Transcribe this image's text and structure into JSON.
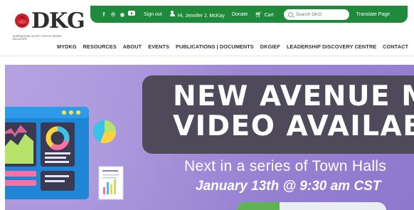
{
  "logo": {
    "text": "DKG",
    "tagline": "International Society for Key Women Educators"
  },
  "topbar": {
    "social_icons": [
      "facebook-icon",
      "pinterest-icon",
      "instagram-icon",
      "youtube-icon"
    ],
    "signout": "Sign out",
    "user": "Hi, Jennifer J. McKay",
    "donate": "Donate",
    "cart": "Cart",
    "search_placeholder": "Search DKG",
    "translate": "Translate Page",
    "bar_color": "#1f8a3b"
  },
  "nav": {
    "items": [
      "MYDKG",
      "RESOURCES",
      "ABOUT",
      "EVENTS",
      "PUBLICATIONS | DOCUMENTS",
      "DKGIEF",
      "LEADERSHIP DISCOVERY CENTRE",
      "CONTACT"
    ]
  },
  "hero": {
    "title_line1": "NEW AVENUE M",
    "title_line2": "VIDEO AVAILABL",
    "subtitle": "Next in a series of Town Halls",
    "datetime": "January 13th @ 9:30 am CST",
    "background": "#9b86d6",
    "title_box": "#4f4a5a"
  }
}
